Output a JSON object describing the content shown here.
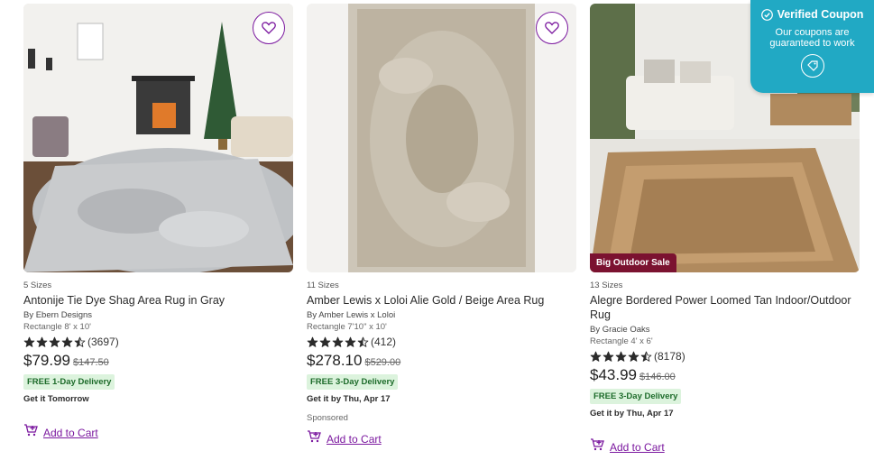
{
  "colors": {
    "accent": "#7b189f",
    "shipping_bg": "#dcf3dd",
    "shipping_text": "#1d6b2a",
    "coupon_bg": "#21a9c4",
    "sale_badge": "#7b1230"
  },
  "products": [
    {
      "sizes": "5 Sizes",
      "title": "Antonije Tie Dye Shag Area Rug in Gray",
      "byline": "By Ebern Designs",
      "dims": "Rectangle 8' x 10'",
      "rating_value": 4.5,
      "rating_count": "(3697)",
      "price": "$79.99",
      "was": "$147.50",
      "shipping": "FREE 1-Day Delivery",
      "eta": "Get it Tomorrow",
      "cart_label": "Add to Cart",
      "badge": ""
    },
    {
      "sizes": "11 Sizes",
      "title": "Amber Lewis x Loloi Alie Gold / Beige Area Rug",
      "byline": "By Amber Lewis x Loloi",
      "dims": "Rectangle 7'10\" x 10'",
      "rating_value": 4.5,
      "rating_count": "(412)",
      "price": "$278.10",
      "was": "$529.00",
      "shipping": "FREE 3-Day Delivery",
      "eta": "Get it by Thu, Apr 17",
      "sponsored": "Sponsored",
      "cart_label": "Add to Cart",
      "badge": ""
    },
    {
      "sizes": "13 Sizes",
      "title": "Alegre Bordered Power Loomed Tan Indoor/Outdoor Rug",
      "byline": "By Gracie Oaks",
      "dims": "Rectangle 4' x 6'",
      "rating_value": 4.5,
      "rating_count": "(8178)",
      "price": "$43.99",
      "was": "$146.00",
      "shipping": "FREE 3-Day Delivery",
      "eta": "Get it by Thu, Apr 17",
      "cart_label": "Add to Cart",
      "badge": "Big Outdoor Sale"
    }
  ],
  "coupon": {
    "title": "Verified Coupon",
    "line1": "Our coupons are",
    "line2": "guaranteed to work",
    "icon": "coupon-tag-icon"
  },
  "icons": {
    "favorite": "heart-outline-icon",
    "cart": "add-to-cart-icon",
    "star": "star-icon",
    "check": "check-circle-icon"
  }
}
